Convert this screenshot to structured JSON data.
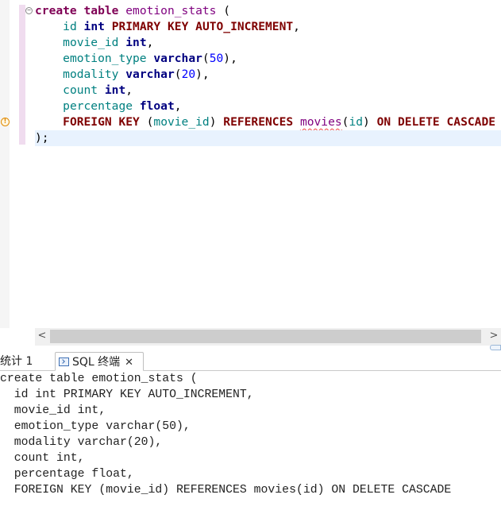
{
  "editor": {
    "lines": [
      {
        "indent": "",
        "parts": [
          [
            "kw",
            "create"
          ],
          [
            "p",
            " "
          ],
          [
            "kw",
            "table"
          ],
          [
            "p",
            " "
          ],
          [
            "tbl",
            "emotion_stats"
          ],
          [
            "p",
            " ("
          ]
        ]
      },
      {
        "indent": "    ",
        "parts": [
          [
            "id",
            "id"
          ],
          [
            "p",
            " "
          ],
          [
            "ty",
            "int"
          ],
          [
            "p",
            " "
          ],
          [
            "kw2",
            "PRIMARY"
          ],
          [
            "p",
            " "
          ],
          [
            "kw2",
            "KEY"
          ],
          [
            "p",
            " "
          ],
          [
            "kw2",
            "AUTO_INCREMENT"
          ],
          [
            "p",
            ","
          ]
        ]
      },
      {
        "indent": "    ",
        "parts": [
          [
            "id",
            "movie_id"
          ],
          [
            "p",
            " "
          ],
          [
            "ty",
            "int"
          ],
          [
            "p",
            ","
          ]
        ]
      },
      {
        "indent": "    ",
        "parts": [
          [
            "id",
            "emotion_type"
          ],
          [
            "p",
            " "
          ],
          [
            "ty",
            "varchar"
          ],
          [
            "p",
            "("
          ],
          [
            "num",
            "50"
          ],
          [
            "p",
            "),"
          ]
        ]
      },
      {
        "indent": "    ",
        "parts": [
          [
            "id",
            "modality"
          ],
          [
            "p",
            " "
          ],
          [
            "ty",
            "varchar"
          ],
          [
            "p",
            "("
          ],
          [
            "num",
            "20"
          ],
          [
            "p",
            "),"
          ]
        ]
      },
      {
        "indent": "    ",
        "parts": [
          [
            "id",
            "count"
          ],
          [
            "p",
            " "
          ],
          [
            "ty",
            "int"
          ],
          [
            "p",
            ","
          ]
        ]
      },
      {
        "indent": "    ",
        "parts": [
          [
            "id",
            "percentage"
          ],
          [
            "p",
            " "
          ],
          [
            "ty",
            "float"
          ],
          [
            "p",
            ","
          ]
        ]
      },
      {
        "indent": "    ",
        "parts": [
          [
            "kw2",
            "FOREIGN"
          ],
          [
            "p",
            " "
          ],
          [
            "kw2",
            "KEY"
          ],
          [
            "p",
            " ("
          ],
          [
            "id",
            "movie_id"
          ],
          [
            "p",
            ") "
          ],
          [
            "kw2",
            "REFERENCES"
          ],
          [
            "p",
            " "
          ],
          [
            "tbl err",
            "movies"
          ],
          [
            "p",
            "("
          ],
          [
            "id",
            "id"
          ],
          [
            "p",
            ") "
          ],
          [
            "kw2",
            "ON"
          ],
          [
            "p",
            " "
          ],
          [
            "kw2",
            "DELETE"
          ],
          [
            "p",
            " "
          ],
          [
            "kw2",
            "CASCADE"
          ]
        ]
      },
      {
        "indent": "",
        "parts": [
          [
            "p",
            ");"
          ]
        ]
      }
    ]
  },
  "scrollbar": {
    "left_arrow": "<",
    "right_arrow": ">"
  },
  "tabs": {
    "stats_label": "统计 1",
    "sql_label": "SQL 终端",
    "close_glyph": "✕"
  },
  "terminal": {
    "lines": [
      "create table emotion_stats (",
      "  id int PRIMARY KEY AUTO_INCREMENT,",
      "  movie_id int,",
      "  emotion_type varchar(50),",
      "  modality varchar(20),",
      "  count int,",
      "  percentage float,",
      "  FOREIGN KEY (movie_id) REFERENCES movies(id) ON DELETE CASCADE"
    ]
  }
}
